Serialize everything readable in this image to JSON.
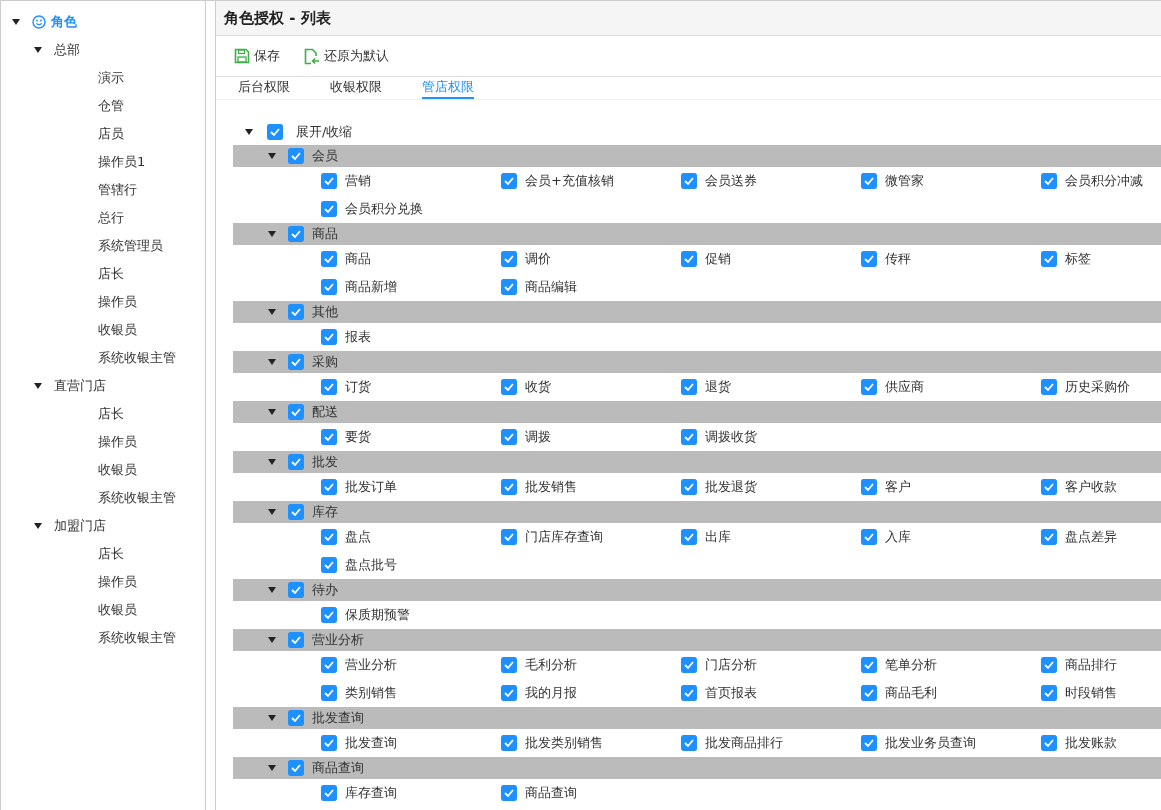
{
  "sidebar": {
    "tree": [
      {
        "label": "角色",
        "expanded": true,
        "selected": true,
        "children": [
          {
            "label": "总部",
            "expanded": true,
            "selected": false,
            "children": [
              {
                "label": "演示",
                "selected": false
              },
              {
                "label": "仓管",
                "selected": false
              },
              {
                "label": "店员",
                "selected": false
              },
              {
                "label": "操作员1",
                "selected": false
              },
              {
                "label": "管辖行",
                "selected": false
              },
              {
                "label": "总行",
                "selected": false
              },
              {
                "label": "系统管理员",
                "selected": false
              },
              {
                "label": "店长",
                "selected": false
              },
              {
                "label": "操作员",
                "selected": false
              },
              {
                "label": "收银员",
                "selected": false
              },
              {
                "label": "系统收银主管",
                "selected": false
              }
            ]
          },
          {
            "label": "直营门店",
            "expanded": true,
            "selected": false,
            "children": [
              {
                "label": "店长",
                "selected": false
              },
              {
                "label": "操作员",
                "selected": false
              },
              {
                "label": "收银员",
                "selected": false
              },
              {
                "label": "系统收银主管",
                "selected": false
              }
            ]
          },
          {
            "label": "加盟门店",
            "expanded": true,
            "selected": false,
            "children": [
              {
                "label": "店长",
                "selected": false
              },
              {
                "label": "操作员",
                "selected": false
              },
              {
                "label": "收银员",
                "selected": false
              },
              {
                "label": "系统收银主管",
                "selected": false
              }
            ]
          }
        ]
      }
    ]
  },
  "panel": {
    "title": "角色授权 - 列表",
    "toolbar": [
      {
        "kind": "save",
        "label": "保存"
      },
      {
        "kind": "restore",
        "label": "还原为默认"
      }
    ],
    "tabs": [
      {
        "label": "后台权限",
        "selected": false
      },
      {
        "label": "收银权限",
        "selected": false
      },
      {
        "label": "管店权限",
        "selected": true
      }
    ],
    "expand_all": {
      "label": "展开/收缩",
      "expanded": true,
      "checked": true
    },
    "groups": [
      {
        "label": "会员",
        "expanded": true,
        "checked": true,
        "items": [
          {
            "label": "营销",
            "checked": true
          },
          {
            "label": "会员+充值核销",
            "checked": true
          },
          {
            "label": "会员送券",
            "checked": true
          },
          {
            "label": "微管家",
            "checked": true
          },
          {
            "label": "会员积分冲减",
            "checked": true
          },
          {
            "label": "会员积分兑换",
            "checked": true
          }
        ]
      },
      {
        "label": "商品",
        "expanded": true,
        "checked": true,
        "items": [
          {
            "label": "商品",
            "checked": true
          },
          {
            "label": "调价",
            "checked": true
          },
          {
            "label": "促销",
            "checked": true
          },
          {
            "label": "传秤",
            "checked": true
          },
          {
            "label": "标签",
            "checked": true
          },
          {
            "label": "商品新增",
            "checked": true
          },
          {
            "label": "商品编辑",
            "checked": true
          }
        ]
      },
      {
        "label": "其他",
        "expanded": true,
        "checked": true,
        "items": [
          {
            "label": "报表",
            "checked": true
          }
        ]
      },
      {
        "label": "采购",
        "expanded": true,
        "checked": true,
        "items": [
          {
            "label": "订货",
            "checked": true
          },
          {
            "label": "收货",
            "checked": true
          },
          {
            "label": "退货",
            "checked": true
          },
          {
            "label": "供应商",
            "checked": true
          },
          {
            "label": "历史采购价",
            "checked": true
          }
        ]
      },
      {
        "label": "配送",
        "expanded": true,
        "checked": true,
        "items": [
          {
            "label": "要货",
            "checked": true
          },
          {
            "label": "调拨",
            "checked": true
          },
          {
            "label": "调拨收货",
            "checked": true
          }
        ]
      },
      {
        "label": "批发",
        "expanded": true,
        "checked": true,
        "items": [
          {
            "label": "批发订单",
            "checked": true
          },
          {
            "label": "批发销售",
            "checked": true
          },
          {
            "label": "批发退货",
            "checked": true
          },
          {
            "label": "客户",
            "checked": true
          },
          {
            "label": "客户收款",
            "checked": true
          }
        ]
      },
      {
        "label": "库存",
        "expanded": true,
        "checked": true,
        "items": [
          {
            "label": "盘点",
            "checked": true
          },
          {
            "label": "门店库存查询",
            "checked": true
          },
          {
            "label": "出库",
            "checked": true
          },
          {
            "label": "入库",
            "checked": true
          },
          {
            "label": "盘点差异",
            "checked": true
          },
          {
            "label": "盘点批号",
            "checked": true
          }
        ]
      },
      {
        "label": "待办",
        "expanded": true,
        "checked": true,
        "items": [
          {
            "label": "保质期预警",
            "checked": true
          }
        ]
      },
      {
        "label": "营业分析",
        "expanded": true,
        "checked": true,
        "items": [
          {
            "label": "营业分析",
            "checked": true
          },
          {
            "label": "毛利分析",
            "checked": true
          },
          {
            "label": "门店分析",
            "checked": true
          },
          {
            "label": "笔单分析",
            "checked": true
          },
          {
            "label": "商品排行",
            "checked": true
          },
          {
            "label": "类别销售",
            "checked": true
          },
          {
            "label": "我的月报",
            "checked": true
          },
          {
            "label": "首页报表",
            "checked": true
          },
          {
            "label": "商品毛利",
            "checked": true
          },
          {
            "label": "时段销售",
            "checked": true
          }
        ]
      },
      {
        "label": "批发查询",
        "expanded": true,
        "checked": true,
        "items": [
          {
            "label": "批发查询",
            "checked": true
          },
          {
            "label": "批发类别销售",
            "checked": true
          },
          {
            "label": "批发商品排行",
            "checked": true
          },
          {
            "label": "批发业务员查询",
            "checked": true
          },
          {
            "label": "批发账款",
            "checked": true
          }
        ]
      },
      {
        "label": "商品查询",
        "expanded": true,
        "checked": true,
        "items": [
          {
            "label": "库存查询",
            "checked": true
          },
          {
            "label": "商品查询",
            "checked": true
          }
        ]
      }
    ]
  }
}
